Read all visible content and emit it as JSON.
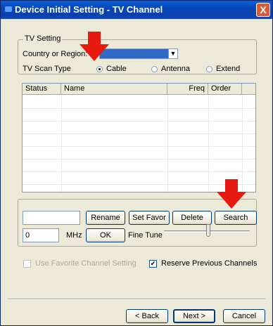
{
  "window": {
    "title": "Device Initial Setting - TV Channel",
    "close_label": "X"
  },
  "tv_setting": {
    "group_label": "TV Setting",
    "country_label": "Country or Region:",
    "country_value": "",
    "scan_type_label": "TV Scan Type",
    "scan_options": [
      "Cable",
      "Antenna",
      "Extend"
    ],
    "selected_scan": "Cable"
  },
  "channel_table": {
    "columns": [
      "Status",
      "Name",
      "Freq",
      "Order"
    ],
    "rows": []
  },
  "controls": {
    "name_input_value": "",
    "rename_label": "Rename",
    "set_favor_label": "Set Favor",
    "delete_label": "Delete",
    "search_label": "Search",
    "freq_input_value": "0",
    "mhz_label": "MHz",
    "ok_label": "OK",
    "fine_tune_label": "Fine Tune",
    "fine_tune_level": 0.5
  },
  "options": {
    "use_favorite_label": "Use Favorite Channel Setting",
    "use_favorite_checked": false,
    "use_favorite_enabled": false,
    "reserve_previous_label": "Reserve Previous Channels",
    "reserve_previous_checked": true
  },
  "footer": {
    "back_label": "< Back",
    "next_label": "Next >",
    "cancel_label": "Cancel"
  },
  "colors": {
    "titlebar": "#0a47b6",
    "dialog_bg": "#ece9d8",
    "annotation_arrow": "#e8190f"
  }
}
